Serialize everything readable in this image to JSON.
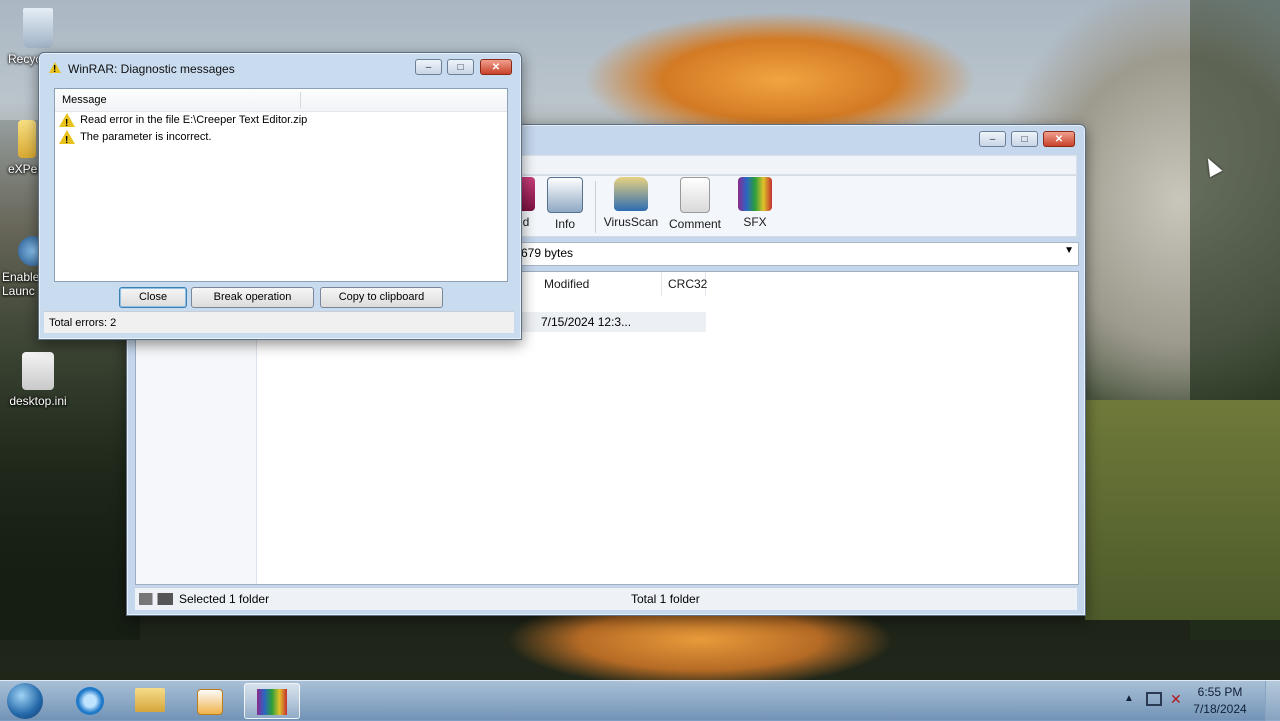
{
  "desktop": {
    "icons": [
      {
        "label": "Recyc",
        "icon": "recycle-bin-icon"
      },
      {
        "label": "eXPer",
        "icon": "folder-icon"
      },
      {
        "label": "Enable\nLaunc",
        "icon": "launcher-icon"
      },
      {
        "label": "desktop.ini",
        "icon": "settings-file-icon"
      }
    ]
  },
  "winrar_main": {
    "toolbar": [
      {
        "label": "d",
        "icon": "delete-icon"
      },
      {
        "label": "Info",
        "icon": "info-icon"
      },
      {
        "label": "VirusScan",
        "icon": "virus-scan-icon"
      },
      {
        "label": "Comment",
        "icon": "comment-icon"
      },
      {
        "label": "SFX",
        "icon": "sfx-icon"
      }
    ],
    "address_text": "679 bytes",
    "columns": {
      "modified": "Modified",
      "crc32": "CRC32"
    },
    "row": {
      "modified": "7/15/2024 12:3..."
    },
    "status": {
      "left": "Selected 1 folder",
      "right": "Total 1 folder"
    }
  },
  "diagnostic": {
    "title": "WinRAR: Diagnostic messages",
    "column_header": "Message",
    "messages": [
      "Read error in the file E:\\Creeper Text Editor.zip",
      "The parameter is incorrect."
    ],
    "buttons": {
      "close": "Close",
      "break": "Break operation",
      "copy": "Copy to clipboard"
    },
    "status": "Total errors: 2"
  },
  "taskbar": {
    "clock_time": "6:55 PM",
    "clock_date": "7/18/2024",
    "apps": [
      "start-orb-icon",
      "internet-explorer-icon",
      "explorer-folder-icon",
      "media-player-icon",
      "winrar-icon"
    ]
  },
  "colors": {
    "accent": "#3c7fb1",
    "warning": "#e8c31e",
    "close_red": "#c8422a"
  }
}
